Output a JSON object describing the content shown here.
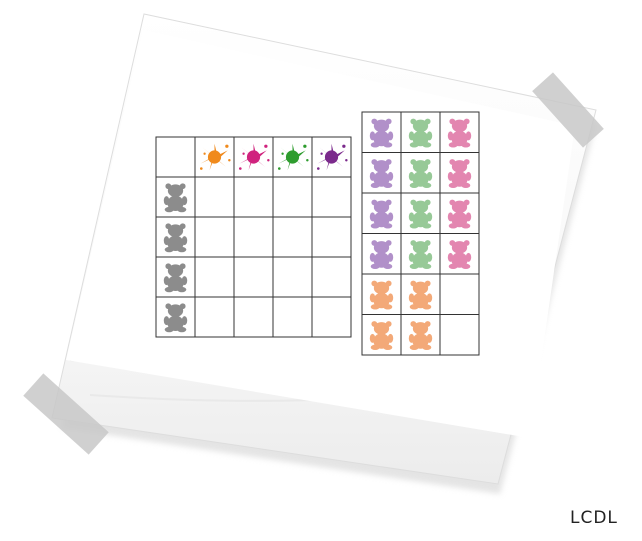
{
  "signature": "LCDL",
  "colors": {
    "paper": "#fbfbfb",
    "paper_shadow": "#d9d9d9",
    "tape": "#c9c9c9",
    "grid_line": "#333333",
    "bear_grey": "#8c8c8c"
  },
  "grid": {
    "columns": [
      {
        "splat_color": "#f08a1c",
        "name": "orange"
      },
      {
        "splat_color": "#d0237e",
        "name": "magenta"
      },
      {
        "splat_color": "#2e9c2e",
        "name": "green"
      },
      {
        "splat_color": "#7b2a8c",
        "name": "purple"
      }
    ],
    "rows": [
      {
        "pose": "sitting"
      },
      {
        "pose": "holding-flower"
      },
      {
        "pose": "standing"
      },
      {
        "pose": "hugging"
      }
    ]
  },
  "pieces": [
    [
      "#a985c4",
      "#8cc48c",
      "#e07aa8"
    ],
    [
      "#a985c4",
      "#8cc48c",
      "#e07aa8"
    ],
    [
      "#a985c4",
      "#8cc48c",
      "#e07aa8"
    ],
    [
      "#a985c4",
      "#8cc48c",
      "#e07aa8"
    ],
    [
      "#f2a06a",
      "#f2a06a",
      ""
    ],
    [
      "#f2a06a",
      "#f2a06a",
      ""
    ]
  ]
}
